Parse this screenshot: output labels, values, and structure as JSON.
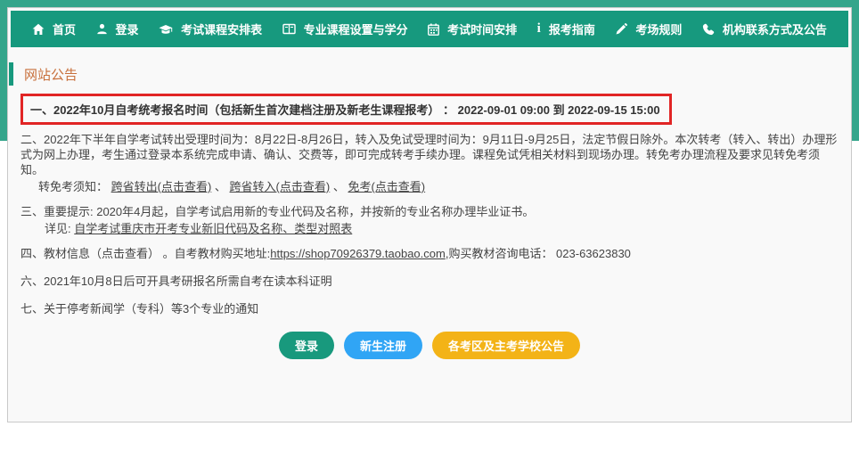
{
  "colors": {
    "band_green": "#35a58b",
    "nav_green": "#17997e",
    "title_orange": "#c8703c",
    "highlight_red": "#e12525",
    "login_button_green": "#18997d",
    "register_button_blue": "#30a5f5",
    "notices_button_yellow": "#f3b317",
    "text_gray": "#444444"
  },
  "nav": {
    "items": [
      {
        "label": "首页",
        "icon": "home-icon"
      },
      {
        "label": "登录",
        "icon": "user-icon"
      },
      {
        "label": "考试课程安排表",
        "icon": "graduation-cap-icon"
      },
      {
        "label": "专业课程设置与学分",
        "icon": "book-icon"
      },
      {
        "label": "考试时间安排",
        "icon": "calendar-icon"
      },
      {
        "label": "报考指南",
        "icon": "info-icon"
      },
      {
        "label": "考场规则",
        "icon": "pencil-icon"
      },
      {
        "label": "机构联系方式及公告",
        "icon": "phone-icon"
      }
    ]
  },
  "announcements": {
    "title": "网站公告",
    "item1": "一、2022年10月自考统考报名时间（包括新生首次建档注册及新老生课程报考） ： 2022-09-01 09:00   到   2022-09-15 15:00",
    "item2": "二、2022年下半年自学考试转出受理时间为：8月22日-8月26日，转入及免试受理时间为：9月11日-9月25日，法定节假日除外。本次转考（转入、转出）办理形式为网上办理，考生通过登录本系统完成申请、确认、交费等，即可完成转考手续办理。课程免试凭相关材料到现场办理。转免考办理流程及要求见转免考须知。",
    "item2_note_label": "转免考须知： ",
    "item2_link_out": "跨省转出(点击查看)",
    "item2_sep1": "、 ",
    "item2_link_in": "跨省转入(点击查看)",
    "item2_sep2": "、 ",
    "item2_link_exempt": "免考(点击查看)",
    "item3": "三、重要提示: 2020年4月起，自学考试启用新的专业代码及名称，并按新的专业名称办理毕业证书。",
    "item3_detail_label": "详见: ",
    "item3_link": "自学考试重庆市开考专业新旧代码及名称、类型对照表",
    "item4_prefix": "四、教材信息（点击查看） 。自考教材购买地址:",
    "item4_link": "https://shop70926379.taobao.com",
    "item4_suffix": ",购买教材咨询电话： 023-63623830",
    "item6": "六、2021年10月8日后可开具考研报名所需自考在读本科证明",
    "item7": "七、关于停考新闻学（专科）等3个专业的通知"
  },
  "buttons": {
    "login": "登录",
    "register": "新生注册",
    "notices": "各考区及主考学校公告"
  }
}
